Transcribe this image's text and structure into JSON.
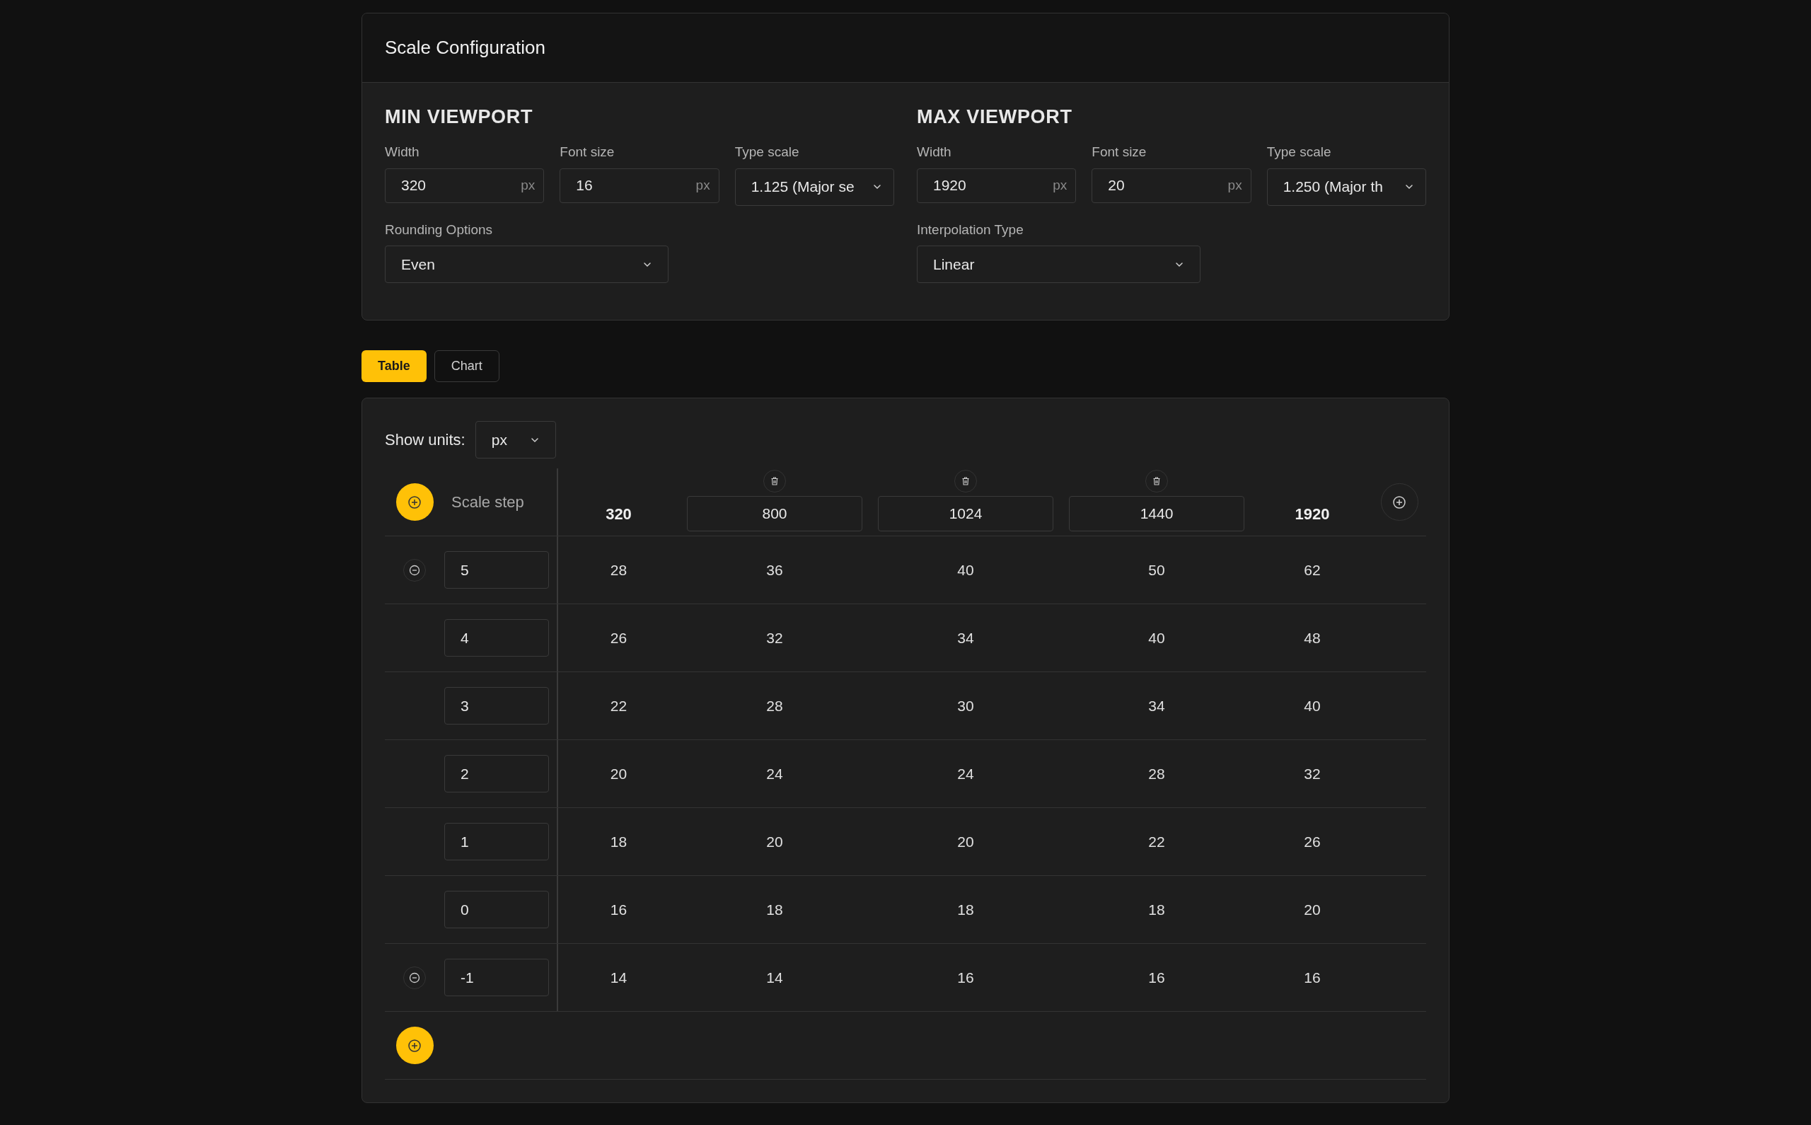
{
  "config": {
    "title": "Scale Configuration",
    "sections": [
      {
        "heading": "MIN VIEWPORT",
        "fields": [
          {
            "kind": "number",
            "label": "Width",
            "value": "320",
            "unit": "px"
          },
          {
            "kind": "number",
            "label": "Font size",
            "value": "16",
            "unit": "px"
          },
          {
            "kind": "select",
            "label": "Type scale",
            "value": "1.125 (Major se"
          }
        ],
        "option": {
          "label": "Rounding Options",
          "value": "Even"
        }
      },
      {
        "heading": "MAX VIEWPORT",
        "fields": [
          {
            "kind": "number",
            "label": "Width",
            "value": "1920",
            "unit": "px"
          },
          {
            "kind": "number",
            "label": "Font size",
            "value": "20",
            "unit": "px"
          },
          {
            "kind": "select",
            "label": "Type scale",
            "value": "1.250 (Major th"
          }
        ],
        "option": {
          "label": "Interpolation Type",
          "value": "Linear"
        }
      }
    ]
  },
  "tabs": [
    {
      "label": "Table",
      "selected": true
    },
    {
      "label": "Chart",
      "selected": false
    }
  ],
  "table": {
    "units_label": "Show units:",
    "units_value": "px",
    "step_heading": "Scale step",
    "columns": [
      {
        "kind": "fixed",
        "label": "320"
      },
      {
        "kind": "editable",
        "label": "800"
      },
      {
        "kind": "editable",
        "label": "1024"
      },
      {
        "kind": "editable",
        "label": "1440"
      },
      {
        "kind": "fixed",
        "label": "1920"
      }
    ],
    "rows": [
      {
        "step": "5",
        "removable": true,
        "values": [
          "28",
          "36",
          "40",
          "50",
          "62"
        ]
      },
      {
        "step": "4",
        "removable": false,
        "values": [
          "26",
          "32",
          "34",
          "40",
          "48"
        ]
      },
      {
        "step": "3",
        "removable": false,
        "values": [
          "22",
          "28",
          "30",
          "34",
          "40"
        ]
      },
      {
        "step": "2",
        "removable": false,
        "values": [
          "20",
          "24",
          "24",
          "28",
          "32"
        ]
      },
      {
        "step": "1",
        "removable": false,
        "values": [
          "18",
          "20",
          "20",
          "22",
          "26"
        ]
      },
      {
        "step": "0",
        "removable": false,
        "values": [
          "16",
          "18",
          "18",
          "18",
          "20"
        ]
      },
      {
        "step": "-1",
        "removable": true,
        "values": [
          "14",
          "14",
          "16",
          "16",
          "16"
        ]
      }
    ]
  }
}
